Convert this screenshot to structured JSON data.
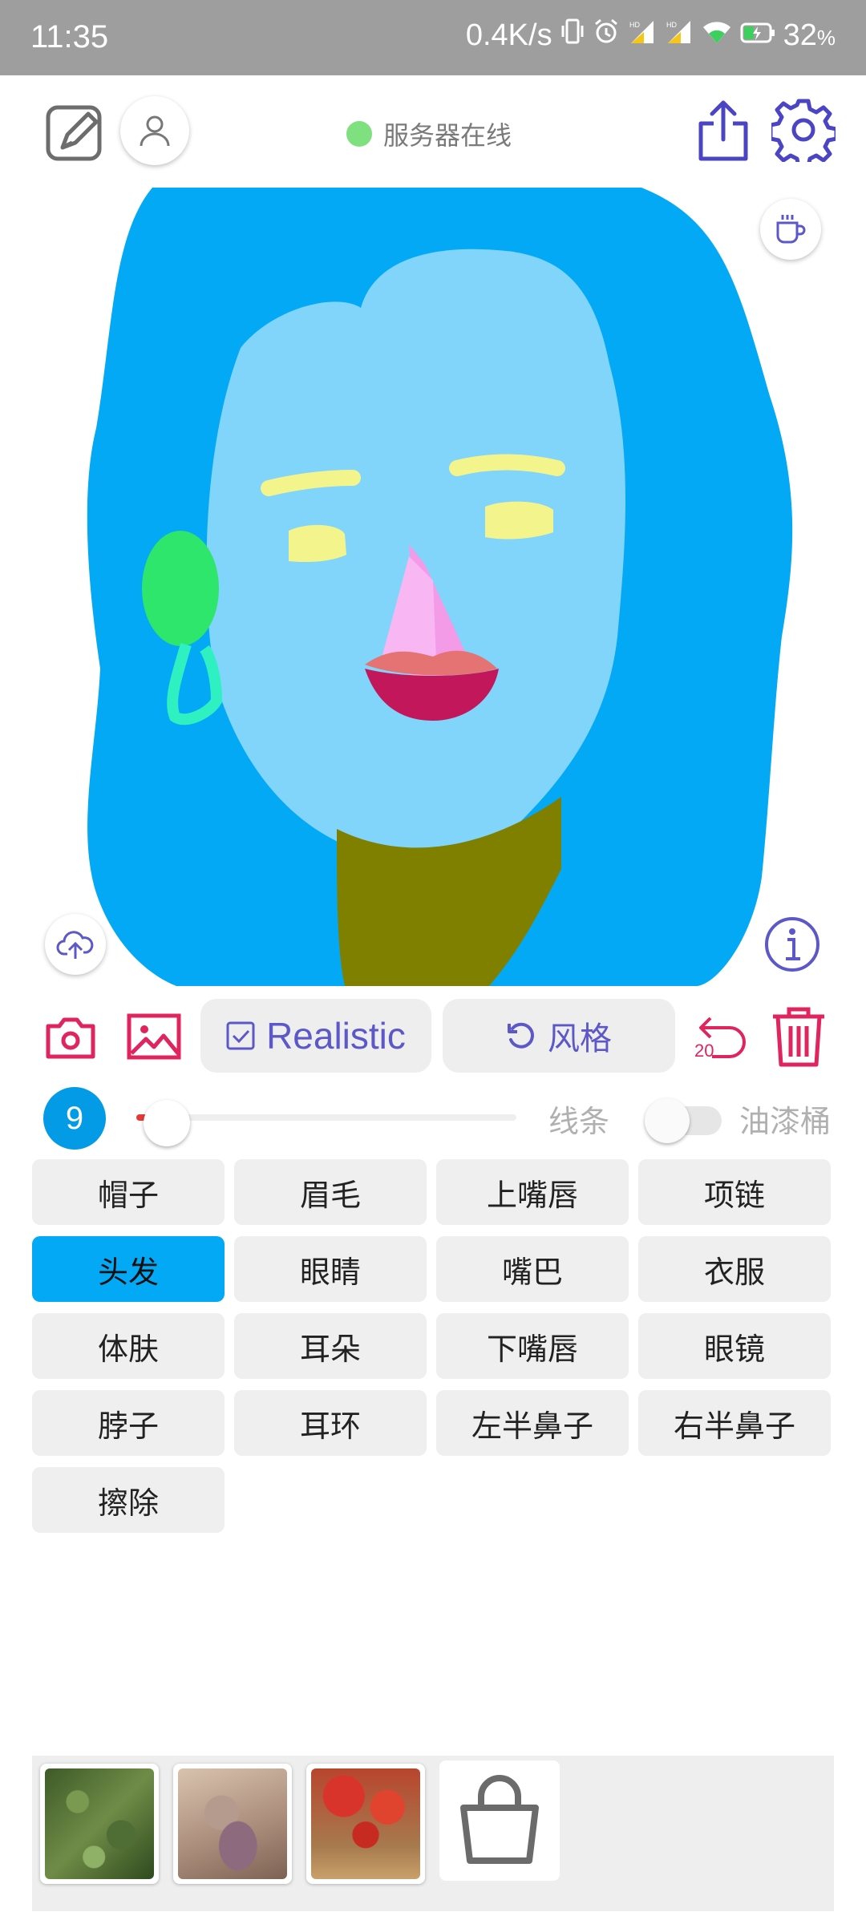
{
  "status_bar": {
    "time": "11:35",
    "network_speed": "0.4K/s",
    "battery": "32",
    "battery_unit": "%",
    "icons": [
      "vibrate-icon",
      "alarm-icon",
      "signal-hd-icon",
      "signal-hd-icon",
      "wifi-icon",
      "battery-charging-icon"
    ]
  },
  "header": {
    "server_status": "服务器在线",
    "server_status_color": "#7ee07e",
    "icons": [
      "edit-icon",
      "user-icon",
      "share-icon",
      "gear-icon"
    ]
  },
  "canvas": {
    "icons": [
      "coffee-icon",
      "cloud-upload-icon",
      "info-icon"
    ]
  },
  "toolbar": {
    "realistic_label": "Realistic",
    "style_label": "风格",
    "undo_count": "20",
    "icons": [
      "camera-icon",
      "image-icon",
      "checkbox-icon",
      "refresh-icon",
      "undo-icon",
      "trash-icon"
    ],
    "accent_color": "#e0245e",
    "button_text_color": "#5c58c8"
  },
  "brush": {
    "size": "9",
    "slider_fraction": 0.08,
    "lines_label": "线条",
    "bucket_label": "油漆桶",
    "bucket_enabled": false
  },
  "categories": [
    {
      "label": "帽子"
    },
    {
      "label": "眉毛"
    },
    {
      "label": "上嘴唇"
    },
    {
      "label": "项链"
    },
    {
      "label": "头发"
    },
    {
      "label": "眼睛"
    },
    {
      "label": "嘴巴"
    },
    {
      "label": "衣服"
    },
    {
      "label": "体肤"
    },
    {
      "label": "耳朵"
    },
    {
      "label": "下嘴唇"
    },
    {
      "label": "眼镜"
    },
    {
      "label": "脖子"
    },
    {
      "label": "耳环"
    },
    {
      "label": "左半鼻子"
    },
    {
      "label": "右半鼻子"
    },
    {
      "label": "擦除"
    }
  ],
  "selected_category": "头发",
  "gallery": {
    "thumbnails": [
      "green-foliage-thumbnail",
      "lace-texture-thumbnail",
      "red-flowers-thumbnail"
    ],
    "icons": [
      "shopping-bag-icon"
    ]
  }
}
